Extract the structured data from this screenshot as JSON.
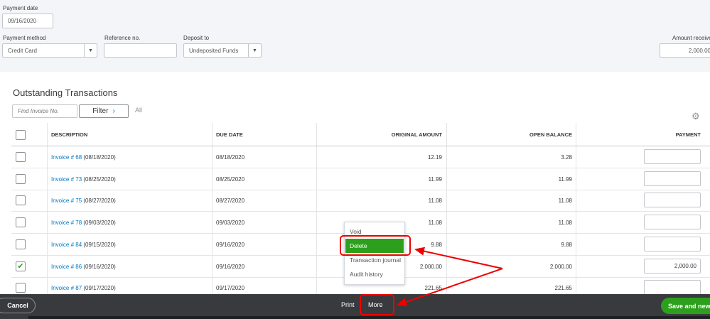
{
  "form": {
    "payment_date_label": "Payment date",
    "payment_date": "09/16/2020",
    "payment_method_label": "Payment method",
    "payment_method": "Credit Card",
    "reference_label": "Reference no.",
    "reference": "",
    "deposit_label": "Deposit to",
    "deposit": "Undeposited Funds",
    "amount_label": "Amount receive",
    "amount": "2,000.00"
  },
  "section": {
    "title": "Outstanding Transactions",
    "find_placeholder": "Find Invoice No.",
    "filter_label": "Filter",
    "all_label": "All"
  },
  "table": {
    "headers": [
      "DESCRIPTION",
      "DUE DATE",
      "ORIGINAL AMOUNT",
      "OPEN BALANCE",
      "PAYMENT"
    ],
    "rows": [
      {
        "link": "Invoice # 68",
        "date_paren": "(08/18/2020)",
        "due": "08/18/2020",
        "original": "12.19",
        "open": "3.28",
        "payment": "",
        "checked": false
      },
      {
        "link": "Invoice # 73",
        "date_paren": "(08/25/2020)",
        "due": "08/25/2020",
        "original": "11.99",
        "open": "11.99",
        "payment": "",
        "checked": false
      },
      {
        "link": "Invoice # 75",
        "date_paren": "(08/27/2020)",
        "due": "08/27/2020",
        "original": "11.08",
        "open": "11.08",
        "payment": "",
        "checked": false
      },
      {
        "link": "Invoice # 78",
        "date_paren": "(09/03/2020)",
        "due": "09/03/2020",
        "original": "11.08",
        "open": "11.08",
        "payment": "",
        "checked": false
      },
      {
        "link": "Invoice # 84",
        "date_paren": "(09/15/2020)",
        "due": "09/16/2020",
        "original": "9.88",
        "open": "9.88",
        "payment": "",
        "checked": false
      },
      {
        "link": "Invoice # 86",
        "date_paren": "(09/16/2020)",
        "due": "09/16/2020",
        "original": "2,000.00",
        "open": "2,000.00",
        "payment": "2,000.00",
        "checked": true
      },
      {
        "link": "Invoice # 87",
        "date_paren": "(09/17/2020)",
        "due": "09/17/2020",
        "original": "221.65",
        "open": "221.65",
        "payment": "",
        "checked": false
      }
    ]
  },
  "menu": {
    "items": [
      "Void",
      "Delete",
      "Transaction journal",
      "Audit history"
    ]
  },
  "footer": {
    "cancel": "Cancel",
    "print": "Print",
    "more": "More",
    "save_new": "Save and new"
  },
  "colors": {
    "accent": "#2ca01c",
    "link": "#0077c5",
    "annotation": "#e00000",
    "footer": "#393a3d"
  }
}
